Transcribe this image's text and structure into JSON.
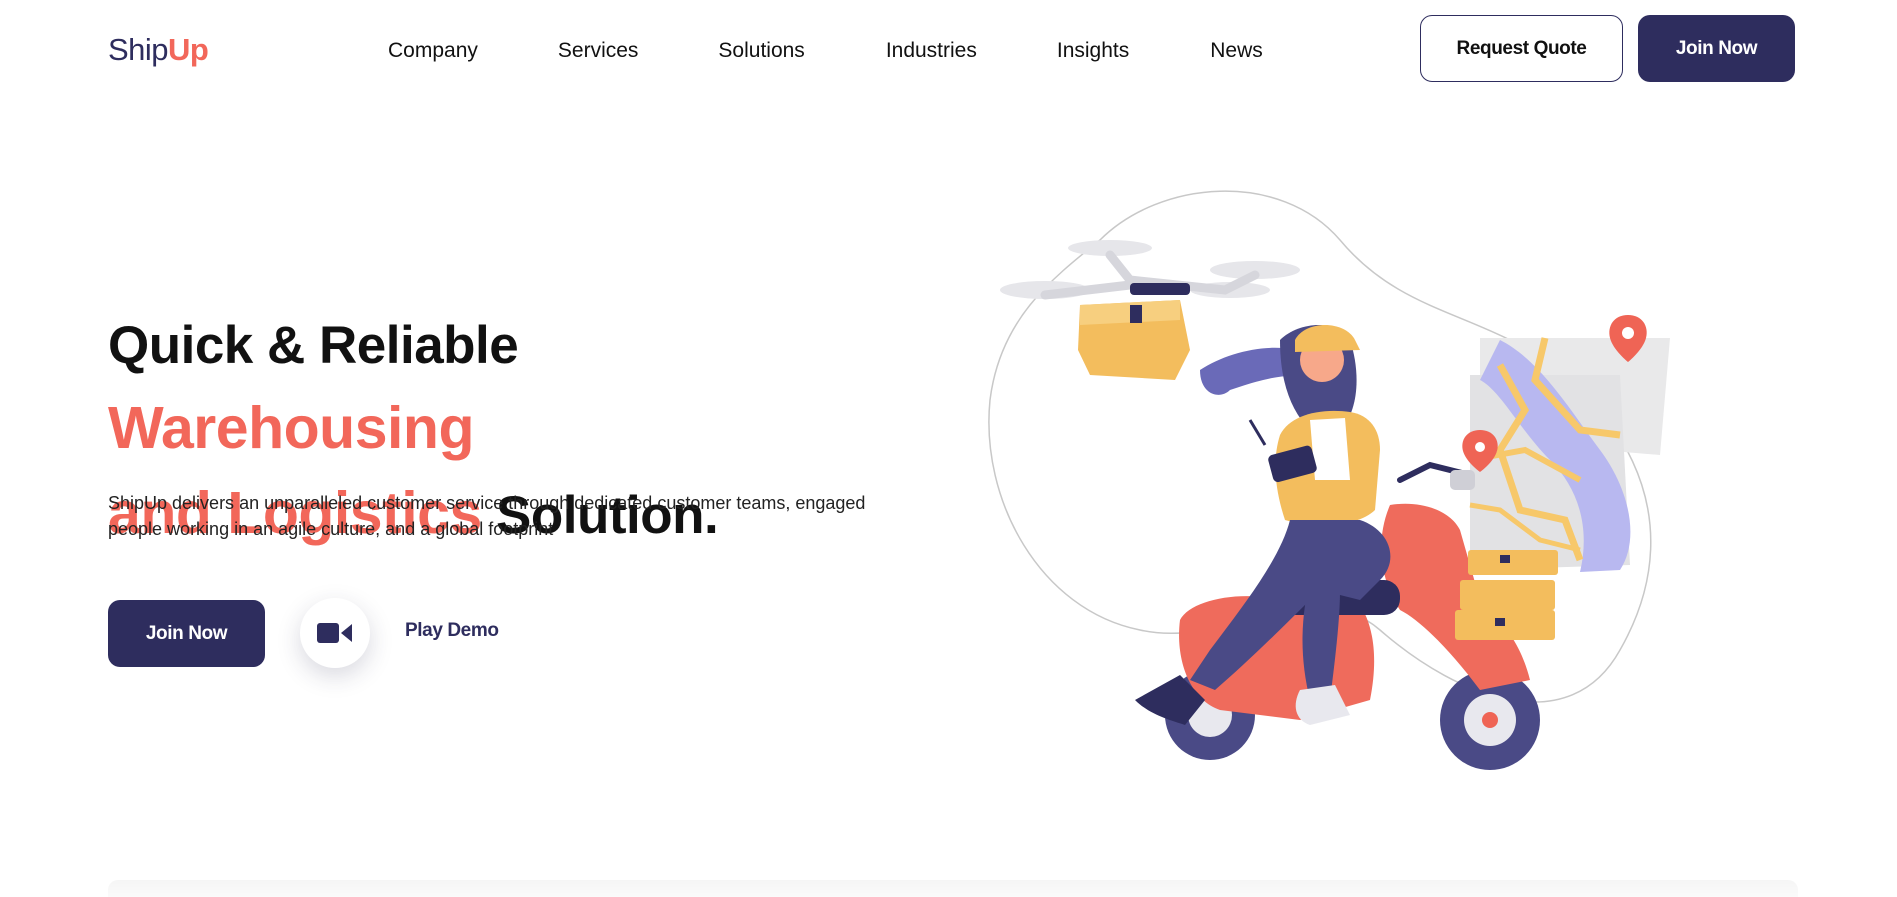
{
  "brand": {
    "name_part1": "Ship",
    "name_part2": "Up",
    "primary_color": "#2e2d5e",
    "accent_color": "#f2675a"
  },
  "nav": {
    "items": [
      {
        "label": "Company"
      },
      {
        "label": "Services"
      },
      {
        "label": "Solutions"
      },
      {
        "label": "Industries"
      },
      {
        "label": "Insights"
      },
      {
        "label": "News"
      }
    ]
  },
  "header_actions": {
    "request_quote_label": "Request Quote",
    "join_now_label": "Join Now"
  },
  "hero": {
    "title_part1": "Quick & Reliable ",
    "title_accent1": "Warehousing",
    "title_accent2": "and Logistics",
    "title_part2": " Solution.",
    "description": "ShipUp delivers an unparalleled customer service through dedicated customer teams, engaged people working in an agile culture, and a global footprint",
    "join_now_label": "Join Now",
    "play_demo_label": "Play Demo",
    "play_icon": "video-camera-icon"
  }
}
